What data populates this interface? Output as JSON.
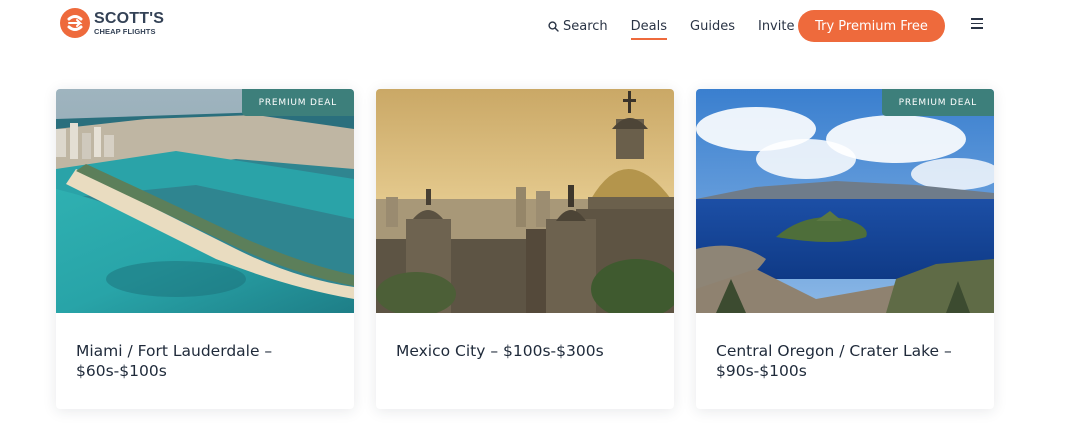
{
  "header": {
    "logo": {
      "title": "SCOTT'S",
      "subtitle": "CHEAP FLIGHTS"
    },
    "nav": [
      {
        "label": "Search",
        "icon": "search-icon"
      },
      {
        "label": "Deals",
        "active": true
      },
      {
        "label": "Guides"
      },
      {
        "label": "Invite"
      }
    ],
    "cta_label": "Try Premium Free",
    "menu_icon": "hamburger-menu-icon"
  },
  "colors": {
    "accent": "#ee6a3c",
    "badge": "#3d7f7b",
    "text": "#1f2a3a"
  },
  "cards": [
    {
      "title": "Miami / Fort Lauderdale – $60s-$100s",
      "badge": "PREMIUM DEAL",
      "image": "miami-beach-aerial-photo"
    },
    {
      "title": "Mexico City – $100s-$300s",
      "badge": "",
      "image": "mexico-city-cathedral-photo"
    },
    {
      "title": "Central Oregon / Crater Lake – $90s-$100s",
      "badge": "PREMIUM DEAL",
      "image": "crater-lake-photo"
    }
  ]
}
